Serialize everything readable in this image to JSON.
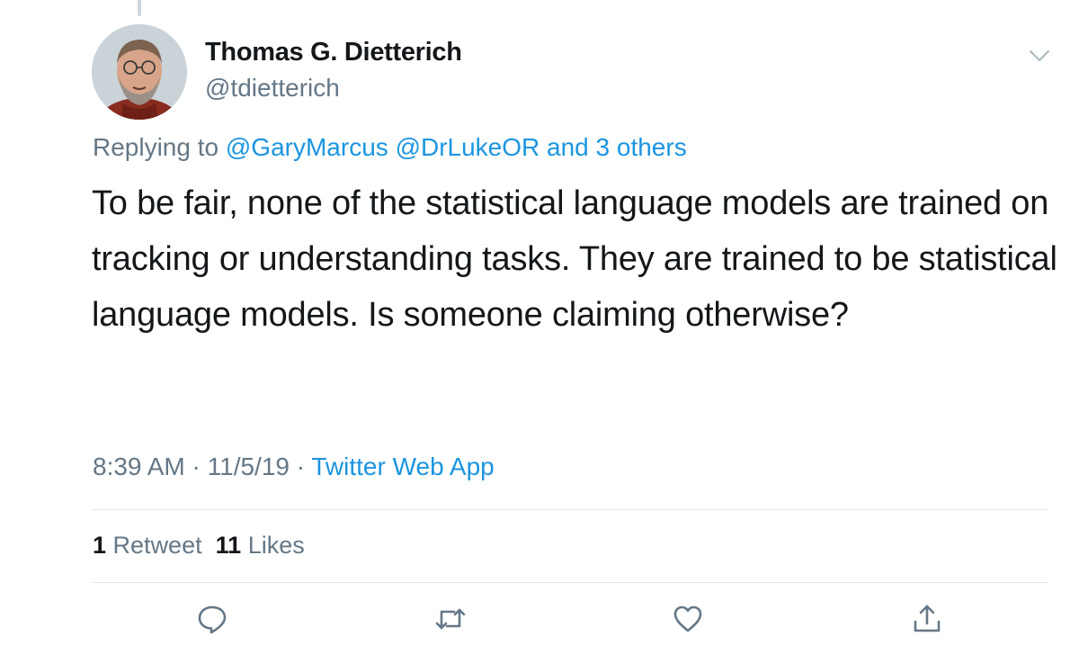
{
  "author": {
    "name": "Thomas G. Dietterich",
    "handle": "@tdietterich"
  },
  "icons": {
    "avatar": "profile-photo",
    "more": "chevron-down-icon",
    "reply": "speech-bubble-icon",
    "retweet": "retweet-arrows-icon",
    "like": "heart-icon",
    "share": "share-upload-icon"
  },
  "reply_context": {
    "prefix": "Replying to ",
    "mentions": [
      "@GaryMarcus",
      "@DrLukeOR"
    ],
    "others": "and 3 others"
  },
  "tweet": {
    "text": "To be fair, none of the statistical language models are trained on tracking or understanding tasks. They are trained to be statistical language models. Is someone claiming otherwise?"
  },
  "meta": {
    "time": "8:39 AM",
    "separator": " · ",
    "date": "11/5/19",
    "source": "Twitter Web App"
  },
  "stats": {
    "retweets_count": "1",
    "retweets_label": "Retweet",
    "likes_count": "11",
    "likes_label": "Likes"
  },
  "colors": {
    "link": "#1b95e0",
    "secondary_text": "#657786",
    "primary_text": "#14171a",
    "divider": "#e1e8ed"
  }
}
